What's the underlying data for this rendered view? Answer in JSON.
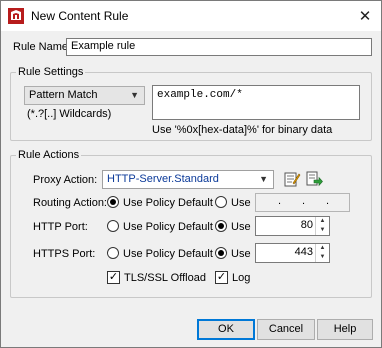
{
  "window": {
    "title": "New Content Rule",
    "close_glyph": "✕"
  },
  "rule_name": {
    "label": "Rule Name:",
    "value": "Example rule"
  },
  "rule_settings": {
    "group_title": "Rule Settings",
    "match_type": "Pattern Match",
    "wildcards_hint": "(*.?[..] Wildcards)",
    "pattern_value": "example.com/*",
    "binary_hint": "Use '%0x[hex-data]%' for binary data"
  },
  "rule_actions": {
    "group_title": "Rule Actions",
    "proxy_action_label": "Proxy Action:",
    "proxy_action_value": "HTTP-Server.Standard",
    "routing_action_label": "Routing Action:",
    "http_port_label": "HTTP Port:",
    "https_port_label": "HTTPS Port:",
    "use_policy_default_label": "Use Policy Default",
    "use_label": "Use",
    "routing_ip_dots": [
      ".",
      ".",
      "."
    ],
    "http_port_value": "80",
    "https_port_value": "443",
    "tls_offload_label": "TLS/SSL Offload",
    "log_label": "Log",
    "selections": {
      "routing": "policy-default",
      "http": "use",
      "https": "use",
      "tls_offload_checked": true,
      "log_checked": true
    }
  },
  "buttons": {
    "ok": "OK",
    "cancel": "Cancel",
    "help": "Help"
  },
  "icons": [
    "firebox-app-icon",
    "close-icon",
    "chevron-down-icon",
    "edit-proxy-icon",
    "clone-proxy-icon",
    "spin-arrows-icon",
    "checkmark-icon"
  ]
}
